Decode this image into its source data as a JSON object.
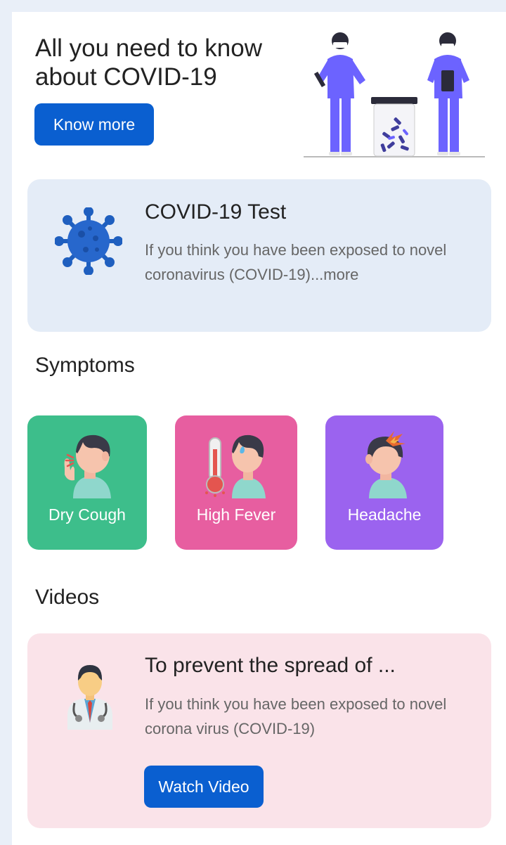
{
  "hero": {
    "title": "All you need to know about COVID-19",
    "button_label": "Know more"
  },
  "test_card": {
    "title": "COVID-19 Test",
    "description": "If you think you have been exposed to novel coronavirus (COVID-19)...more",
    "icon": "virus-icon"
  },
  "symptoms": {
    "title": "Symptoms",
    "items": [
      {
        "label": "Dry Cough",
        "icon": "cough-icon",
        "color": "#3dbe8b"
      },
      {
        "label": "High Fever",
        "icon": "fever-icon",
        "color": "#e75ea0"
      },
      {
        "label": "Headache",
        "icon": "headache-icon",
        "color": "#9b63ef"
      }
    ]
  },
  "videos": {
    "title": "Videos",
    "card": {
      "title": "To prevent the spread of ...",
      "description": "If you think you have been exposed to novel corona virus (COVID-19)",
      "button_label": "Watch Video",
      "icon": "doctor-icon"
    }
  },
  "colors": {
    "primary": "#0a5fd0",
    "test_card_bg": "#e4ecf7",
    "video_card_bg": "#fae3e9"
  }
}
